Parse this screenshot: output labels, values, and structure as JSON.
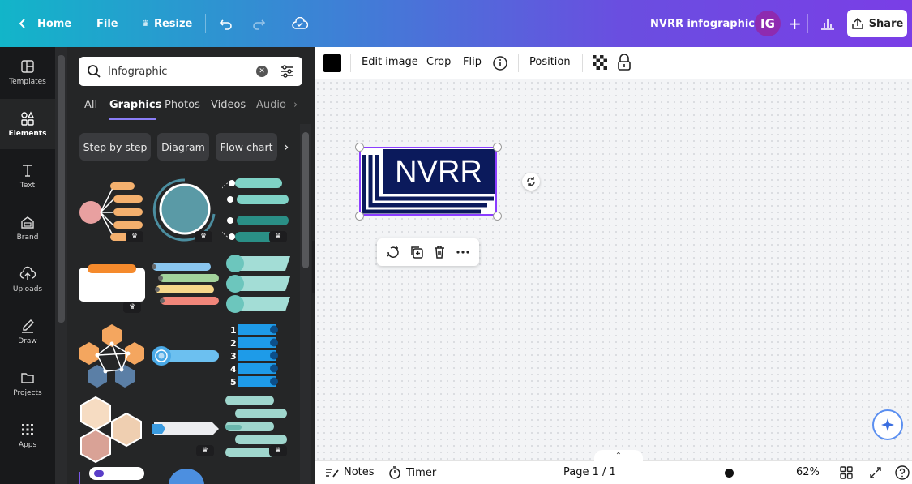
{
  "topbar": {
    "home_label": "Home",
    "file_label": "File",
    "resize_label": "Resize",
    "doc_title": "NVRR infographic",
    "avatar_initials": "IG",
    "share_label": "Share"
  },
  "rail": {
    "items": [
      {
        "label": "Templates",
        "icon": "templates-icon"
      },
      {
        "label": "Elements",
        "icon": "elements-icon",
        "active": true
      },
      {
        "label": "Text",
        "icon": "text-icon"
      },
      {
        "label": "Brand",
        "icon": "brand-icon"
      },
      {
        "label": "Uploads",
        "icon": "uploads-icon"
      },
      {
        "label": "Draw",
        "icon": "draw-icon"
      },
      {
        "label": "Projects",
        "icon": "projects-icon"
      },
      {
        "label": "Apps",
        "icon": "apps-icon"
      }
    ]
  },
  "panel": {
    "search_value": "Infographic",
    "tabs": [
      "All",
      "Graphics",
      "Photos",
      "Videos",
      "Audio"
    ],
    "active_tab": "Graphics",
    "chips": [
      "Step by step",
      "Diagram",
      "Flow chart"
    ],
    "list_numbers": [
      "1",
      "2",
      "3",
      "4",
      "5"
    ]
  },
  "context_toolbar": {
    "edit_image": "Edit image",
    "crop": "Crop",
    "flip": "Flip",
    "position": "Position"
  },
  "canvas": {
    "logo_text": "NVRR"
  },
  "bottombar": {
    "notes": "Notes",
    "timer": "Timer",
    "page": "Page 1 / 1",
    "zoom": "62%"
  },
  "colors": {
    "accent": "#8b3dff",
    "logo_navy": "#0b1a5c",
    "rail_bg": "#18191b",
    "panel_bg": "#252627"
  }
}
